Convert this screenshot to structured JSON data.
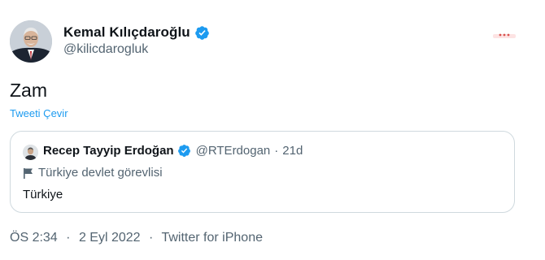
{
  "author": {
    "name": "Kemal Kılıçdaroğlu",
    "handle": "@kilicdarogluk"
  },
  "tweet": {
    "text": "Zam",
    "translate_label": "Tweeti Çevir"
  },
  "quoted_tweet": {
    "name": "Recep Tayyip Erdoğan",
    "handle": "@RTErdogan",
    "separator": "·",
    "age": "21d",
    "label": "Türkiye devlet görevlisi",
    "text": "Türkiye"
  },
  "footer": {
    "time": "ÖS 2:34",
    "separator": "·",
    "date": "2 Eyl 2022",
    "source": "Twitter for iPhone"
  },
  "colors": {
    "verified": "#1d9bf0",
    "link": "#1d9bf0",
    "secondary_text": "#536471",
    "border": "#cfd9de"
  }
}
